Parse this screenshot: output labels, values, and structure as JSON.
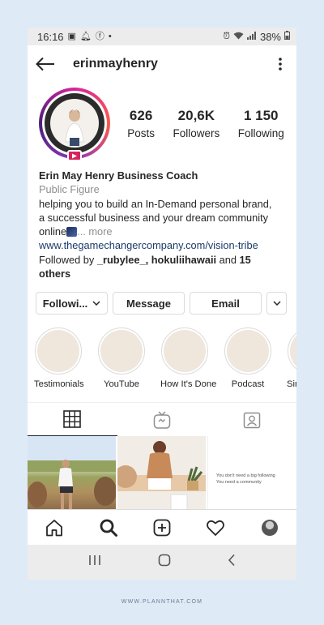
{
  "status_bar": {
    "time": "16:16",
    "battery": "38%"
  },
  "header": {
    "username": "erinmayhenry"
  },
  "profile": {
    "stats": [
      {
        "value": "626",
        "label": "Posts"
      },
      {
        "value": "20,6K",
        "label": "Followers"
      },
      {
        "value": "1 150",
        "label": "Following"
      }
    ],
    "name": "Erin May Henry Business Coach",
    "category": "Public Figure",
    "bio_line1": "helping you to build an In-Demand personal brand,",
    "bio_line2": "a successful business and your dream community",
    "bio_line3": "online",
    "bio_more": "... more",
    "link": "www.thegamechangercompany.com/vision-tribe",
    "followed_by_prefix": "Followed by ",
    "followed_by_users": "_rubylee_, hokuliihawaii",
    "followed_by_and": " and ",
    "followed_by_others": "15 others"
  },
  "actions": {
    "following": "Followi...",
    "message": "Message",
    "email": "Email"
  },
  "highlights": [
    {
      "label": "Testimonials"
    },
    {
      "label": "YouTube"
    },
    {
      "label": "How It's Done"
    },
    {
      "label": "Podcast"
    },
    {
      "label": "Simp"
    }
  ],
  "posts": {
    "post3_line1": "You don't need a big following",
    "post3_line2": "You need a community"
  },
  "footer": {
    "site": "WWW.PLANNTHAT.COM"
  },
  "colors": {
    "background": "#dfeaf7",
    "story_ring": "#d6249f",
    "link": "#1b3a6b",
    "highlight_fill": "#efe6dc"
  }
}
